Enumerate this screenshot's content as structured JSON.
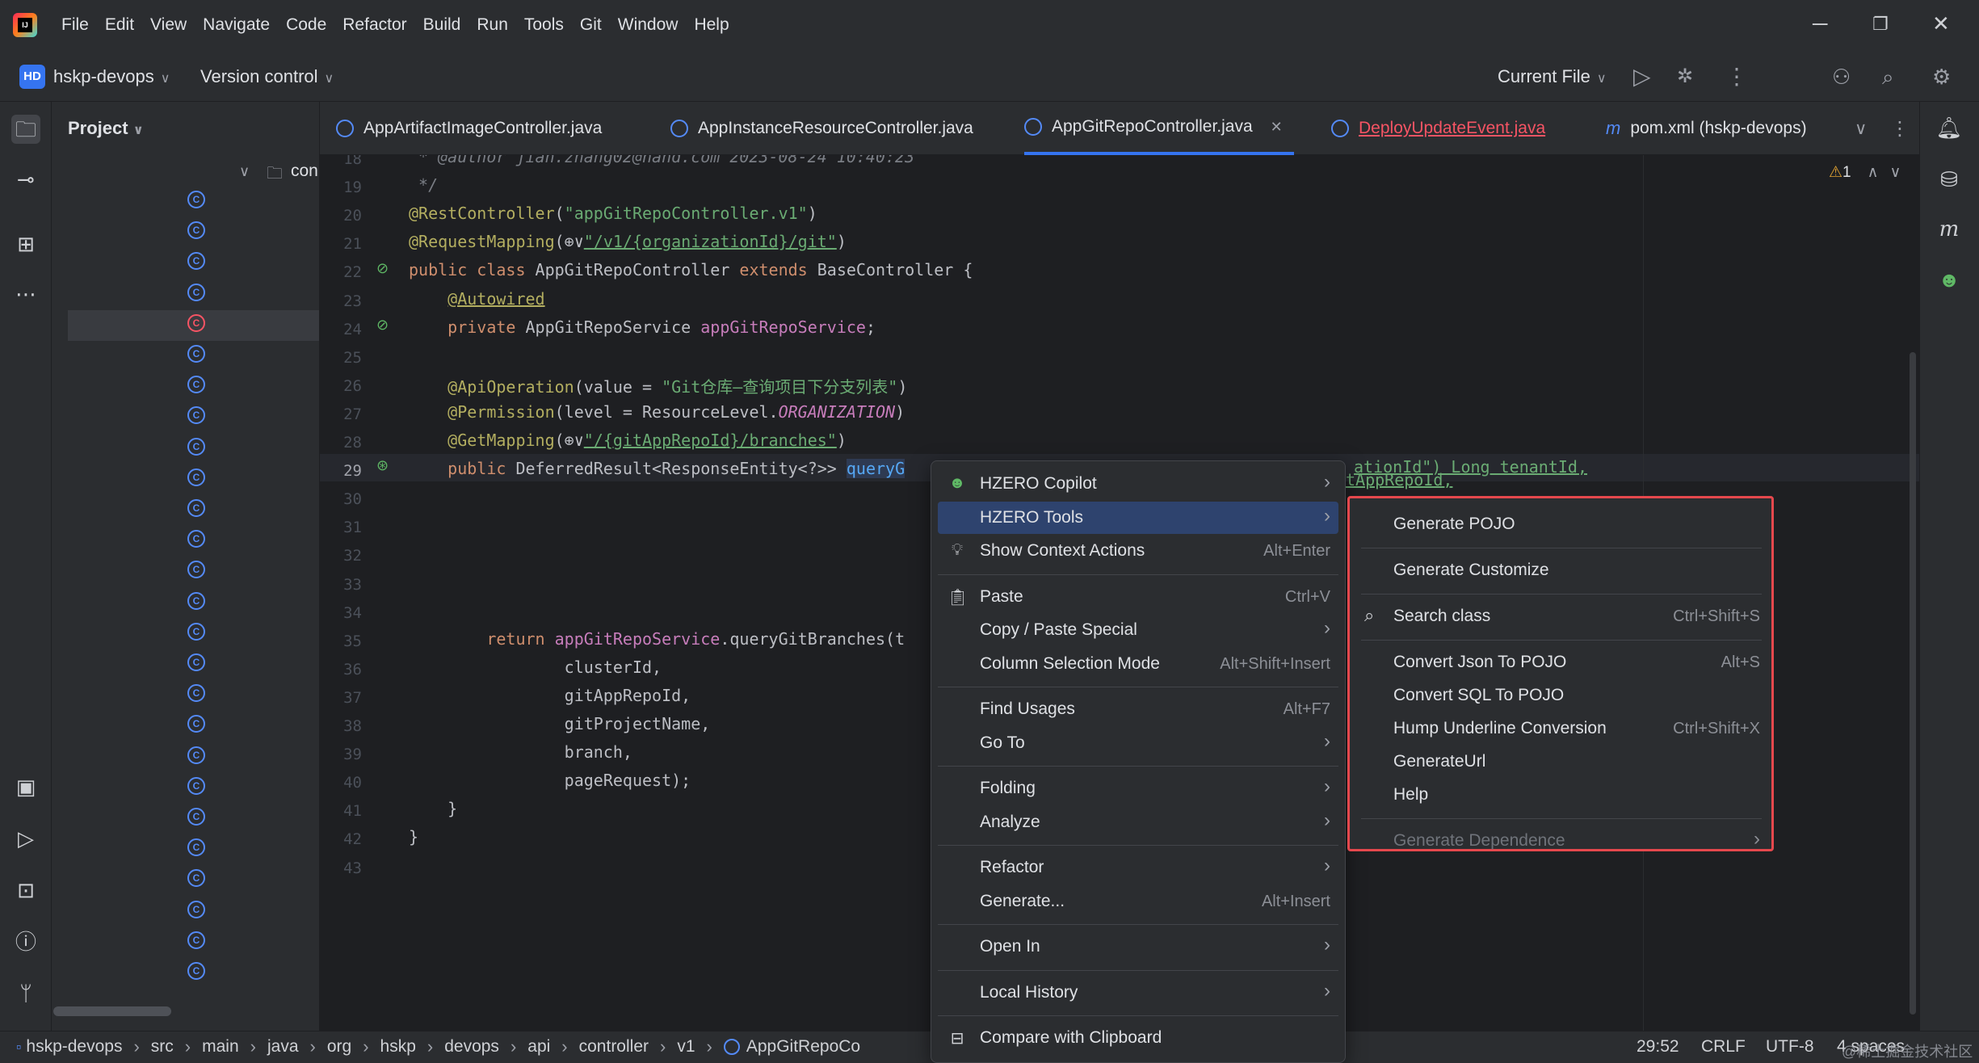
{
  "menubar": {
    "items": [
      "File",
      "Edit",
      "View",
      "Navigate",
      "Code",
      "Refactor",
      "Build",
      "Run",
      "Tools",
      "Git",
      "Window",
      "Help"
    ]
  },
  "toolbar": {
    "project_badge": "HD",
    "project_name": "hskp-devops",
    "vcs": "Version control",
    "run_config": "Current File"
  },
  "project_panel": {
    "title": "Project",
    "folder": "con"
  },
  "tabs": [
    {
      "label": "AppArtifactImageController.java",
      "active": false
    },
    {
      "label": "AppInstanceResourceController.java",
      "active": false
    },
    {
      "label": "AppGitRepoController.java",
      "active": true
    },
    {
      "label": "DeployUpdateEvent.java",
      "active": false
    },
    {
      "label": "pom.xml (hskp-devops)",
      "active": false
    }
  ],
  "editor": {
    "warning_count": "1",
    "lines": [
      {
        "n": "18",
        "html": "<span class='com'> * @author jian.zhang02@hand.com 2023-08-24 10:40:23</span>"
      },
      {
        "n": "19",
        "html": "<span class='com'> */</span>"
      },
      {
        "n": "20",
        "html": "<span class='ann'>@RestController</span>(<span class='str'>\"appGitRepoController.v1\"</span>)"
      },
      {
        "n": "21",
        "html": "<span class='ann'>@RequestMapping</span>(⊕∨<span class='url'>\"/v1/{organizationId}/git\"</span>)"
      },
      {
        "n": "22",
        "html": "<span class='kw'>public class</span> AppGitRepoController <span class='kw'>extends</span> BaseController {"
      },
      {
        "n": "23",
        "html": "    <span class='ann' style='text-decoration:underline'>@Autowired</span>"
      },
      {
        "n": "24",
        "html": "    <span class='kw'>private</span> AppGitRepoService <span class='fld'>appGitRepoService</span>;"
      },
      {
        "n": "25",
        "html": ""
      },
      {
        "n": "26",
        "html": "    <span class='ann'>@ApiOperation</span>(value = <span class='str'>\"Git仓库—查询项目下分支列表\"</span>)"
      },
      {
        "n": "27",
        "html": "    <span class='ann'>@Permission</span>(level = ResourceLevel.<span class='it'>ORGANIZATION</span>)"
      },
      {
        "n": "28",
        "html": "    <span class='ann'>@GetMapping</span>(⊕∨<span class='url'>\"/{gitAppRepoId}/branches\"</span>)"
      },
      {
        "n": "29",
        "html": "    <span class='kw'>public</span> DeferredResult&lt;ResponseEntity&lt;?&gt;&gt; <span style='color:#56a8f5;background:#2e3a52'>queryG</span>"
      },
      {
        "n": "30",
        "html": ""
      },
      {
        "n": "31",
        "html": ""
      },
      {
        "n": "32",
        "html": ""
      },
      {
        "n": "33",
        "html": ""
      },
      {
        "n": "34",
        "html": ""
      },
      {
        "n": "35",
        "html": "        <span class='kw'>return</span> <span class='fld'>appGitRepoService</span>.queryGitBranches(t"
      },
      {
        "n": "36",
        "html": "                clusterId,"
      },
      {
        "n": "37",
        "html": "                gitAppRepoId,"
      },
      {
        "n": "38",
        "html": "                gitProjectName,"
      },
      {
        "n": "39",
        "html": "                branch,"
      },
      {
        "n": "40",
        "html": "                pageRequest);"
      },
      {
        "n": "41",
        "html": "    }"
      },
      {
        "n": "42",
        "html": "}"
      },
      {
        "n": "43",
        "html": ""
      }
    ],
    "line29_tail": "ationId\") Long tenantId,",
    "line30_tail": "tAppRepoId,"
  },
  "context_menu": {
    "items": [
      {
        "label": "HZERO Copilot",
        "shortcut": "",
        "submenu": true,
        "icon": "copilot"
      },
      {
        "label": "HZERO Tools",
        "shortcut": "",
        "submenu": true,
        "selected": true
      },
      {
        "label": "Show Context Actions",
        "shortcut": "Alt+Enter",
        "icon": "bulb"
      },
      {
        "sep": true
      },
      {
        "label": "Paste",
        "shortcut": "Ctrl+V",
        "icon": "paste"
      },
      {
        "label": "Copy / Paste Special",
        "shortcut": "",
        "submenu": true
      },
      {
        "label": "Column Selection Mode",
        "shortcut": "Alt+Shift+Insert"
      },
      {
        "sep": true
      },
      {
        "label": "Find Usages",
        "shortcut": "Alt+F7"
      },
      {
        "label": "Go To",
        "shortcut": "",
        "submenu": true
      },
      {
        "sep": true
      },
      {
        "label": "Folding",
        "shortcut": "",
        "submenu": true
      },
      {
        "label": "Analyze",
        "shortcut": "",
        "submenu": true
      },
      {
        "sep": true
      },
      {
        "label": "Refactor",
        "shortcut": "",
        "submenu": true
      },
      {
        "label": "Generate...",
        "shortcut": "Alt+Insert"
      },
      {
        "sep": true
      },
      {
        "label": "Open In",
        "shortcut": "",
        "submenu": true
      },
      {
        "sep": true
      },
      {
        "label": "Local History",
        "shortcut": "",
        "submenu": true
      },
      {
        "sep": true
      },
      {
        "label": "Compare with Clipboard",
        "shortcut": "",
        "icon": "compare"
      }
    ]
  },
  "submenu": {
    "items": [
      {
        "label": "Generate POJO",
        "shortcut": ""
      },
      {
        "sep": true
      },
      {
        "label": "Generate Customize",
        "shortcut": ""
      },
      {
        "sep": true
      },
      {
        "label": "Search class",
        "shortcut": "Ctrl+Shift+S",
        "icon": "search"
      },
      {
        "sep": true
      },
      {
        "label": "Convert Json To POJO",
        "shortcut": "Alt+S"
      },
      {
        "label": "Convert SQL To POJO",
        "shortcut": ""
      },
      {
        "label": "Hump Underline Conversion",
        "shortcut": "Ctrl+Shift+X"
      },
      {
        "label": "GenerateUrl",
        "shortcut": ""
      },
      {
        "label": "Help",
        "shortcut": ""
      },
      {
        "sep": true
      },
      {
        "label": "Generate Dependence",
        "shortcut": "",
        "disabled": true,
        "submenu": true
      }
    ]
  },
  "statusbar": {
    "breadcrumbs": [
      "hskp-devops",
      "src",
      "main",
      "java",
      "org",
      "hskp",
      "devops",
      "api",
      "controller",
      "v1",
      "AppGitRepoCo"
    ],
    "position": "29:52",
    "line_sep": "CRLF",
    "encoding": "UTF-8",
    "indent": "4 spaces",
    "watermark": "@稀土掘金技术社区"
  }
}
